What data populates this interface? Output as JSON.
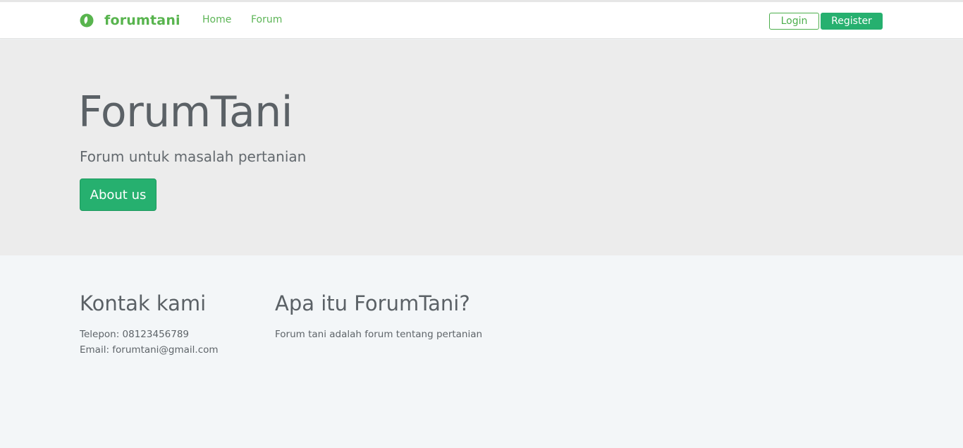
{
  "navbar": {
    "brand": "forumtani",
    "links": [
      {
        "label": "Home"
      },
      {
        "label": "Forum"
      }
    ],
    "login_label": "Login",
    "register_label": "Register",
    "brand_color": "#58b44e",
    "accent_color": "#26b06f"
  },
  "hero": {
    "title": "ForumTani",
    "subtitle": "Forum untuk masalah pertanian",
    "about_button": "About us"
  },
  "footer": {
    "contact": {
      "heading": "Kontak kami",
      "phone": "Telepon: 08123456789",
      "email": "Email: forumtani@gmail.com"
    },
    "about": {
      "heading": "Apa itu ForumTani?",
      "text": "Forum tani adalah forum tentang pertanian"
    }
  }
}
